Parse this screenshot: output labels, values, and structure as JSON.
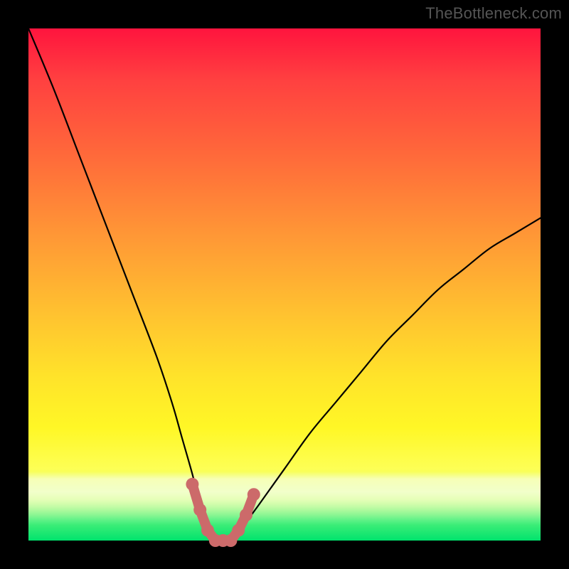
{
  "watermark": "TheBottleneck.com",
  "colors": {
    "background": "#000000",
    "curve": "#000000",
    "marker_fill": "#cc6a6a",
    "gradient_top": "#ff143e",
    "gradient_bottom": "#00e36d"
  },
  "chart_data": {
    "type": "line",
    "title": "",
    "xlabel": "",
    "ylabel": "",
    "xlim": [
      0,
      100
    ],
    "ylim": [
      0,
      100
    ],
    "series": [
      {
        "name": "bottleneck-curve",
        "x": [
          0,
          5,
          10,
          15,
          20,
          25,
          28,
          30,
          32,
          33,
          34,
          35,
          36,
          37,
          38,
          39,
          40,
          42,
          45,
          50,
          55,
          60,
          65,
          70,
          75,
          80,
          85,
          90,
          95,
          100
        ],
        "values": [
          100,
          88,
          75,
          62,
          49,
          36,
          27,
          20,
          13,
          9,
          6,
          3,
          1,
          0,
          0,
          0,
          1,
          3,
          7,
          14,
          21,
          27,
          33,
          39,
          44,
          49,
          53,
          57,
          60,
          63
        ]
      }
    ],
    "markers": {
      "name": "highlighted-points",
      "x": [
        32,
        33.5,
        35,
        36.5,
        38,
        39.5,
        41,
        42.5,
        44
      ],
      "values": [
        11,
        6,
        2,
        0,
        0,
        0,
        2,
        5,
        9
      ]
    }
  }
}
